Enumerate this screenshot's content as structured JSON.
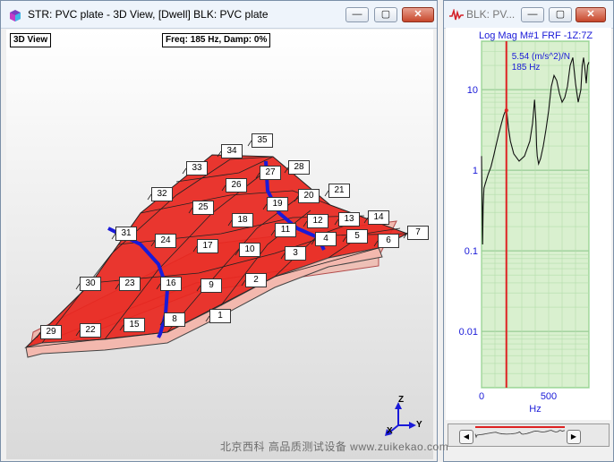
{
  "left_window": {
    "title": "STR: PVC plate - 3D View,   [Dwell] BLK: PVC plate",
    "minimize": "—",
    "maximize": "▢",
    "close": "✕",
    "view_label": "3D View",
    "freq_label": "Freq: 185 Hz, Damp: 0%",
    "axes": {
      "z": "Z",
      "y": "Y",
      "x": "X"
    },
    "points": [
      "1",
      "2",
      "3",
      "4",
      "5",
      "6",
      "7",
      "8",
      "9",
      "10",
      "11",
      "12",
      "13",
      "14",
      "15",
      "16",
      "17",
      "18",
      "19",
      "20",
      "21",
      "22",
      "23",
      "24",
      "25",
      "26",
      "27",
      "28",
      "29",
      "30",
      "31",
      "32",
      "33",
      "34",
      "35"
    ]
  },
  "right_window": {
    "title": "BLK: PV...",
    "minimize": "—",
    "maximize": "▢",
    "close": "✕",
    "scroll_left": "◀",
    "scroll_right": "▶"
  },
  "colors": {
    "mode_shape": "#e8261e",
    "undeformed": "#f2a89b",
    "plot_bg": "#d9f0cf",
    "cursor": "#dd2222"
  },
  "chart_data": {
    "type": "line",
    "title": "Log Mag M#1 FRF -1Z:7Z",
    "cursor_readout": [
      "5.54 (m/s^2)/N",
      "185 Hz"
    ],
    "xlabel": "Hz",
    "ylabel": "",
    "x_ticks": [
      "0",
      "500"
    ],
    "y_ticks": [
      "10",
      "1",
      "0.1",
      "0.01"
    ],
    "yscale": "log",
    "xlim": [
      0,
      800
    ],
    "ylim": [
      0.002,
      40
    ],
    "cursor_x": 185,
    "grid": true,
    "series": [
      {
        "x": [
          0,
          8,
          12,
          18,
          30,
          50,
          70,
          90,
          110,
          130,
          150,
          165,
          175,
          182,
          185,
          190,
          200,
          215,
          240,
          280,
          320,
          360,
          380,
          395,
          405,
          410,
          415,
          425,
          440,
          460,
          480,
          500,
          520,
          540,
          560,
          580,
          600,
          620,
          640,
          660,
          680,
          700,
          720,
          740,
          750,
          760,
          770,
          780,
          790,
          800
        ],
        "y": [
          1.5,
          0.12,
          0.35,
          0.6,
          0.7,
          0.9,
          1.1,
          1.5,
          2.1,
          2.9,
          3.9,
          4.8,
          5.3,
          5.5,
          5.54,
          4.9,
          3.4,
          2.3,
          1.6,
          1.3,
          1.5,
          2.3,
          3.8,
          7.5,
          4.0,
          2.0,
          1.5,
          1.2,
          1.4,
          2.0,
          3.2,
          5.5,
          11,
          15,
          13,
          9,
          7,
          8,
          11,
          20,
          25,
          12,
          7,
          10,
          20,
          25,
          18,
          12,
          20,
          22
        ]
      }
    ]
  },
  "watermark": "北京西科  高品质测试设备  www.zuikekao.com"
}
